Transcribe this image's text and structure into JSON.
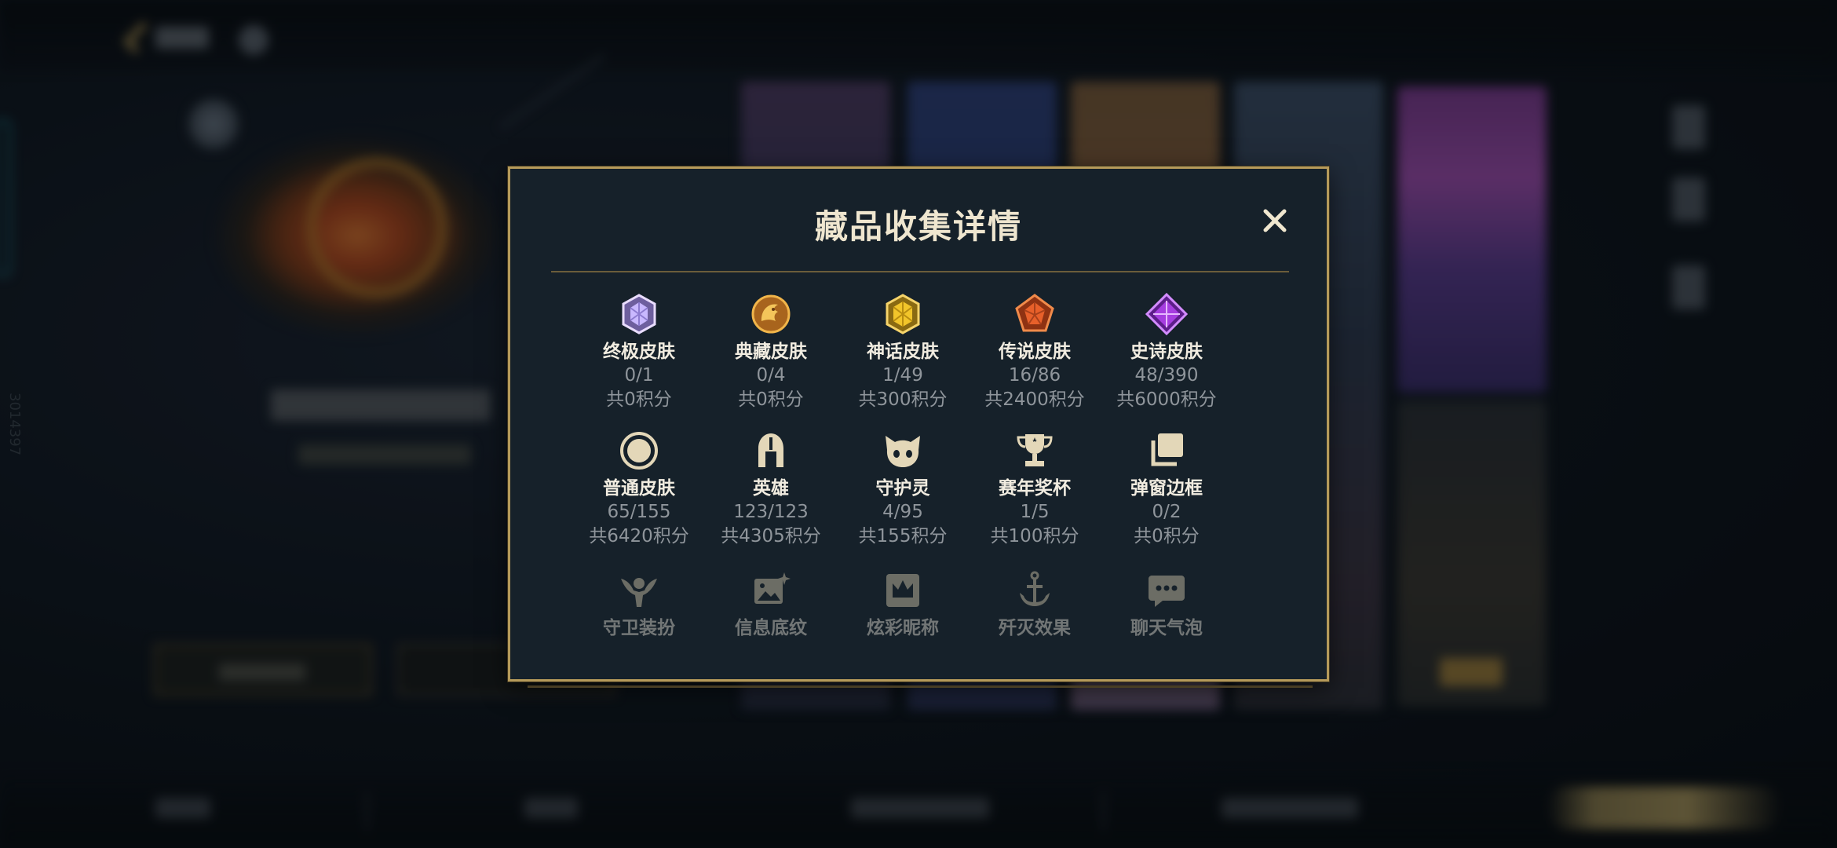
{
  "background": {
    "side_number": "3014397"
  },
  "modal": {
    "title": "藏品收集详情",
    "close_label": "×",
    "categories": [
      {
        "name": "终极皮肤",
        "count": "0/1",
        "points": "共0积分",
        "icon": "ultimate-gem-icon",
        "color": "#b9a7f0"
      },
      {
        "name": "典藏皮肤",
        "count": "0/4",
        "points": "共0积分",
        "icon": "dragon-coin-icon",
        "color": "#d79a30"
      },
      {
        "name": "神话皮肤",
        "count": "1/49",
        "points": "共300积分",
        "icon": "mythic-gem-icon",
        "color": "#e4b624"
      },
      {
        "name": "传说皮肤",
        "count": "16/86",
        "points": "共2400积分",
        "icon": "legendary-gem-icon",
        "color": "#e2612a"
      },
      {
        "name": "史诗皮肤",
        "count": "48/390",
        "points": "共6000积分",
        "icon": "epic-gem-icon",
        "color": "#9a3dd6"
      },
      {
        "name": "普通皮肤",
        "count": "65/155",
        "points": "共6420积分",
        "icon": "ring-icon",
        "color": "#e3d7b8"
      },
      {
        "name": "英雄",
        "count": "123/123",
        "points": "共4305积分",
        "icon": "helmet-icon",
        "color": "#e3d7b8"
      },
      {
        "name": "守护灵",
        "count": "4/95",
        "points": "共155积分",
        "icon": "cat-spirit-icon",
        "color": "#e3d7b8"
      },
      {
        "name": "赛年奖杯",
        "count": "1/5",
        "points": "共100积分",
        "icon": "trophy-icon",
        "color": "#e3d7b8"
      },
      {
        "name": "弹窗边框",
        "count": "0/2",
        "points": "共0积分",
        "icon": "stacked-frames-icon",
        "color": "#e3d7b8"
      },
      {
        "name": "守卫装扮",
        "icon": "ward-icon",
        "color": "#e3d7b8"
      },
      {
        "name": "信息底纹",
        "icon": "sparkle-card-icon",
        "color": "#e3d7b8"
      },
      {
        "name": "炫彩昵称",
        "icon": "crown-card-icon",
        "color": "#e3d7b8"
      },
      {
        "name": "歼灭效果",
        "icon": "anchor-icon",
        "color": "#e3d7b8"
      },
      {
        "name": "聊天气泡",
        "icon": "chat-bubble-icon",
        "color": "#e3d7b8"
      }
    ]
  },
  "colors": {
    "modal_border": "#b59a5a",
    "modal_bg": "#16212a",
    "title": "#efe6cf",
    "muted_text": "#8f959b"
  }
}
